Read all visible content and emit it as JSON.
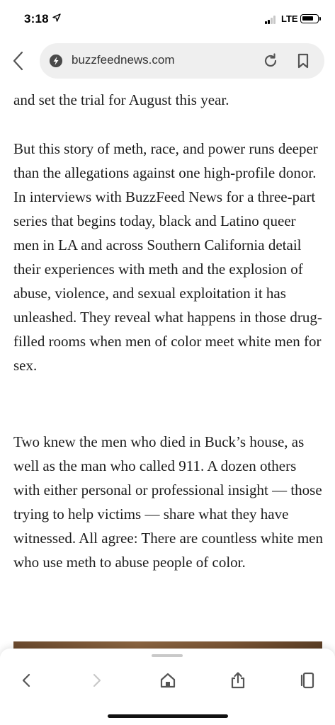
{
  "status_bar": {
    "time": "3:18",
    "network": "LTE",
    "icons": [
      "location-arrow-icon",
      "cellular-signal-icon",
      "battery-icon"
    ]
  },
  "browser": {
    "url": "buzzfeednews.com",
    "icons": [
      "back-chevron-icon",
      "site-icon",
      "reload-icon",
      "bookmark-icon"
    ]
  },
  "article": {
    "paragraphs": [
      "and set the trial for August this year.",
      "But this story of meth, race, and power runs deeper than the allegations against one high-profile donor. In interviews with BuzzFeed News for a three-part series that begins today, black and Latino queer men in LA and across Southern California detail their experiences with meth and the explosion of abuse, violence, and sexual exploitation it has unleashed. They reveal what happens in those drug-filled rooms when men of color meet white men for sex.",
      "Two knew the men who died in Buck’s house, as well as the man who called 911. A dozen others with either personal or professional insight — those trying to help victims — share what they have witnessed. All agree: There are countless white men who use meth to abuse people of color."
    ]
  },
  "toolbar": {
    "icons": [
      "back-icon",
      "forward-icon",
      "home-icon",
      "share-icon",
      "tabs-icon"
    ]
  },
  "colors": {
    "text": "#1c1c1c",
    "url_pill": "#efefef",
    "icon": "#555555",
    "disabled_icon": "#c8c8c8"
  }
}
